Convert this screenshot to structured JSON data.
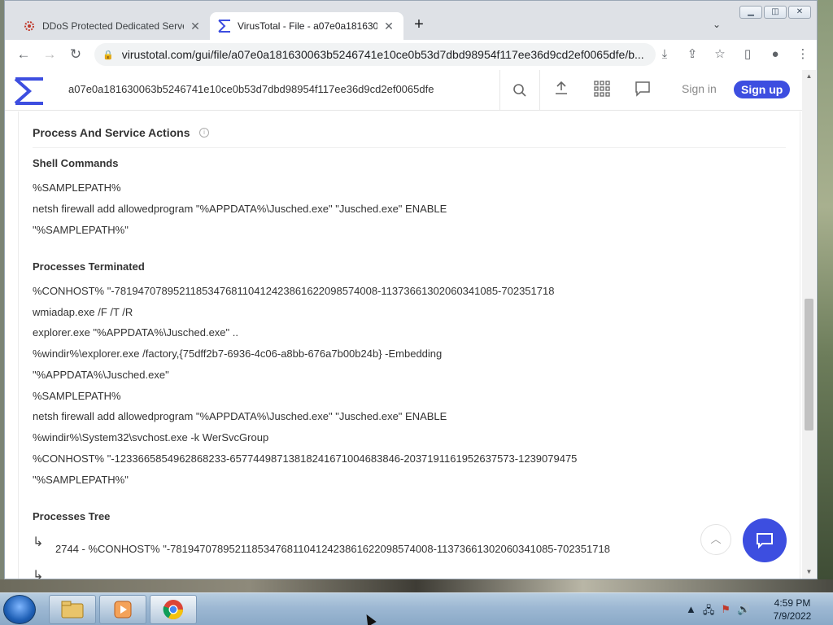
{
  "browser": {
    "tabs": [
      {
        "title": "DDoS Protected Dedicated Serve",
        "active": false
      },
      {
        "title": "VirusTotal - File - a07e0a181630",
        "active": true
      }
    ],
    "new_tab": "+",
    "url": "virustotal.com/gui/file/a07e0a181630063b5246741e10ce0b53d7dbd98954f117ee36d9cd2ef0065dfe/b..."
  },
  "vt": {
    "search_value": "a07e0a181630063b5246741e10ce0b53d7dbd98954f117ee36d9cd2ef0065dfe",
    "sign_in": "Sign in",
    "sign_up": "Sign up",
    "accent": "#3d4ee0"
  },
  "section": {
    "title": "Process And Service Actions",
    "shell_commands": {
      "heading": "Shell Commands",
      "items": [
        "%SAMPLEPATH%",
        "netsh firewall add allowedprogram \"%APPDATA%\\Jusched.exe\" \"Jusched.exe\" ENABLE",
        "\"%SAMPLEPATH%\""
      ]
    },
    "processes_terminated": {
      "heading": "Processes Terminated",
      "items": [
        "%CONHOST% \"-781947078952118534768110412423861622098574008-1137366130206034108​5-702351718",
        "wmiadap.exe /F /T /R",
        "explorer.exe \"%APPDATA%\\Jusched.exe\" ..",
        "%windir%\\explorer.exe /factory,{75dff2b7-6936-4c06-a8bb-676a7b00b24b} -Embedding",
        "\"%APPDATA%\\Jusched.exe\"",
        "%SAMPLEPATH%",
        "netsh firewall add allowedprogram \"%APPDATA%\\Jusched.exe\" \"Jusched.exe\" ENABLE",
        "%windir%\\System32\\svchost.exe -k WerSvcGroup",
        "%CONHOST% \"-12336658549628682​33-657744987138182416710046838​46-2037191161952637573-1239079475",
        "\"%SAMPLEPATH%\""
      ]
    },
    "processes_tree": {
      "heading": "Processes Tree",
      "items": [
        "2744 - %CONHOST% \"-781947078952118534768110412423861622098574008-1137366130206034108​5-702351718"
      ]
    }
  },
  "taskbar": {
    "time": "4:59 PM",
    "date": "7/9/2022"
  }
}
